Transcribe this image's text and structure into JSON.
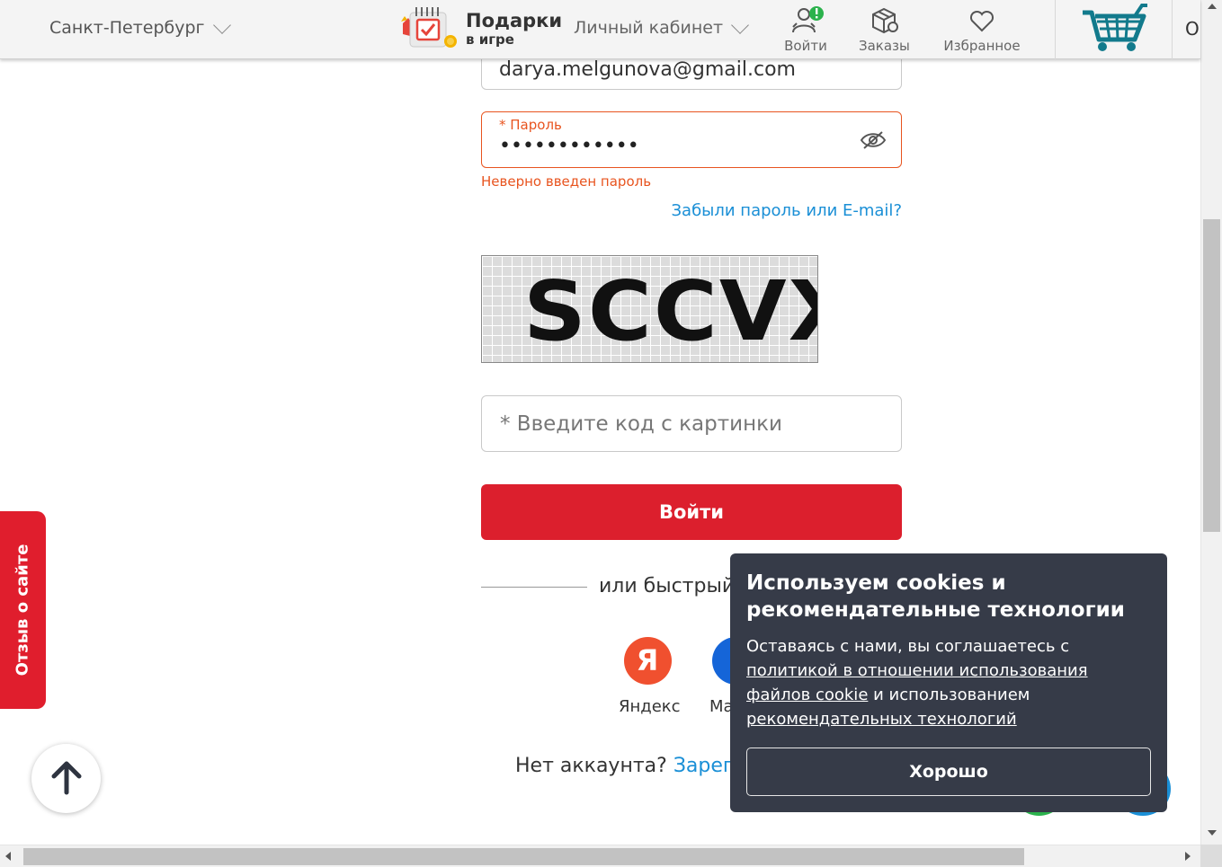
{
  "header": {
    "city": "Санкт-Петербург",
    "gifts_title": "Подарки",
    "gifts_subtitle": "в игре",
    "cabinet": "Личный кабинет",
    "login": "Войти",
    "orders": "Заказы",
    "favorites": "Избранное",
    "cut_letter": "О"
  },
  "form": {
    "email_value": "darya.melgunova@gmail.com",
    "password_label": "* Пароль",
    "password_mask": "••••••••••••",
    "password_error": "Неверно введен пароль",
    "forgot_link": "Забыли пароль или E-mail?",
    "captcha_text": "SCCVX",
    "captcha_placeholder": "* Введите код с картинки",
    "login_button": "Войти",
    "quick_login_text": "или быстрый",
    "social": {
      "yandex_label": "Яндекс",
      "yandex_glyph": "Я",
      "mail_label": "Ма"
    },
    "no_account": "Нет аккаунта?",
    "register_link": "Зареги"
  },
  "side": {
    "feedback": "Отзыв о сайте"
  },
  "cookie": {
    "title": "Используем cookies и рекомендательные технологии",
    "text_before": "Оставаясь с нами, вы соглашаетесь с ",
    "policy_link": "политикой в отношении использования файлов cookie",
    "text_middle": " и использованием ",
    "tech_link": "рекомендательных технологий",
    "ok_button": "Хорошо"
  },
  "colors": {
    "accent_red": "#dc1f2d",
    "error_orange": "#e8541f",
    "link_blue": "#1a8fd6",
    "cookie_bg": "#363b48",
    "cart_teal": "#127a8c"
  }
}
